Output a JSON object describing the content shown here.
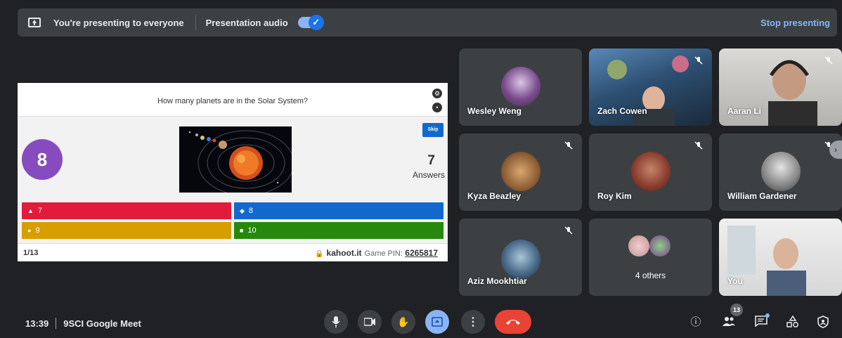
{
  "presenting_bar": {
    "message": "You're presenting to everyone",
    "audio_label": "Presentation audio",
    "audio_enabled": true,
    "stop_label": "Stop presenting"
  },
  "kahoot": {
    "question": "How many planets are in the Solar System?",
    "timer": "8",
    "skip_label": "Skip",
    "answers_count": "7",
    "answers_label": "Answers",
    "options": [
      {
        "symbol": "triangle",
        "label": "7",
        "color": "#e21b3c"
      },
      {
        "symbol": "diamond",
        "label": "8",
        "color": "#1368ce"
      },
      {
        "symbol": "circle",
        "label": "9",
        "color": "#d89e00"
      },
      {
        "symbol": "square",
        "label": "10",
        "color": "#26890c"
      }
    ],
    "page": "1/13",
    "site": "kahoot.it",
    "pin_label": "Game PIN:",
    "pin": "6265817"
  },
  "participants": [
    {
      "name": "Wesley Weng",
      "muted": false,
      "type": "avatar"
    },
    {
      "name": "Zach Cowen",
      "muted": true,
      "type": "video"
    },
    {
      "name": "Aaran Li",
      "muted": true,
      "type": "video"
    },
    {
      "name": "Kyza Beazley",
      "muted": true,
      "type": "avatar"
    },
    {
      "name": "Roy Kim",
      "muted": true,
      "type": "avatar"
    },
    {
      "name": "William Gardener",
      "muted": true,
      "type": "avatar"
    },
    {
      "name": "Aziz Mookhtiar",
      "muted": true,
      "type": "avatar"
    },
    {
      "name": "4 others",
      "muted": false,
      "type": "group"
    },
    {
      "name": "You",
      "muted": false,
      "type": "video"
    }
  ],
  "bottom_bar": {
    "time": "13:39",
    "meeting_name": "9SCI Google Meet",
    "people_count": "13"
  },
  "icons": {
    "mic": "mic-icon",
    "camera": "camera-icon",
    "hand": "raise-hand-icon",
    "present": "present-icon",
    "more": "more-options-icon",
    "hangup": "hangup-icon",
    "info": "info-icon",
    "people": "people-icon",
    "chat": "chat-icon",
    "activities": "activities-icon",
    "host": "host-controls-icon"
  },
  "colors": {
    "background": "#202124",
    "accent": "#8ab4f8",
    "hangup": "#ea4335",
    "timer": "#864cbf"
  }
}
